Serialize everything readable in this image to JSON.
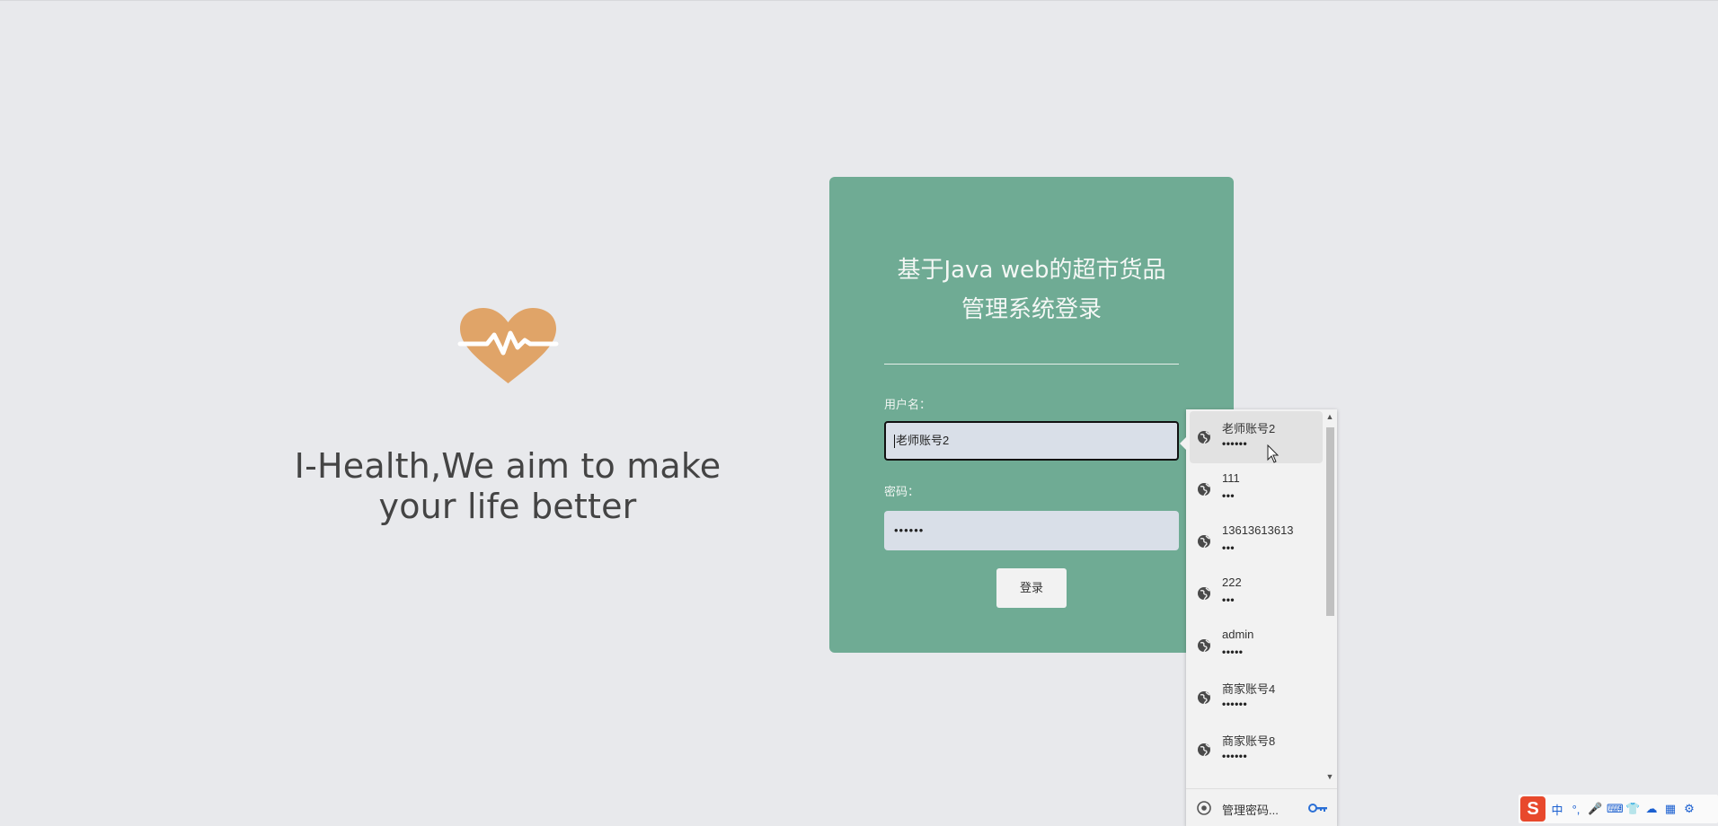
{
  "hero": {
    "tagline_line1": "I-Health,We aim to make",
    "tagline_line2": "your life better",
    "logo_color": "#e0a468"
  },
  "login": {
    "title_line1": "基于Java web的超市货品",
    "title_line2": "管理系统登录",
    "username_label": "用户名：",
    "username_value": "老师账号2",
    "password_label": "密码：",
    "password_value": "••••••",
    "submit_label": "登录",
    "card_color": "#6fab94"
  },
  "autocomplete": {
    "items": [
      {
        "username": "老师账号2",
        "password": "••••••"
      },
      {
        "username": "111",
        "password": "•••"
      },
      {
        "username": "13613613613",
        "password": "•••"
      },
      {
        "username": "222",
        "password": "•••"
      },
      {
        "username": "admin",
        "password": "•••••"
      },
      {
        "username": "商家账号4",
        "password": "••••••"
      },
      {
        "username": "商家账号8",
        "password": "••••••"
      }
    ],
    "manage_label": "管理密码..."
  },
  "ime": {
    "lang": "中",
    "punct": "°,"
  }
}
